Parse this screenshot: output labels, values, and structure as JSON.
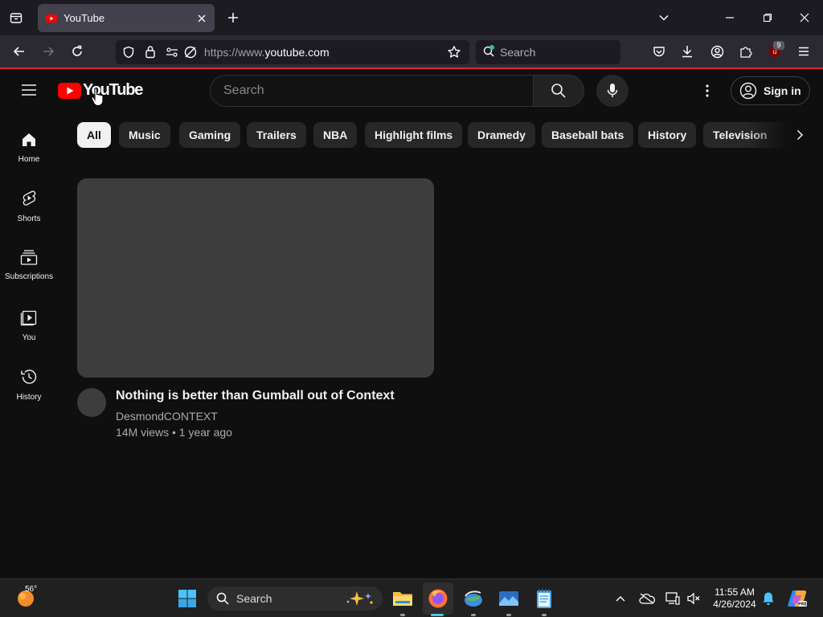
{
  "browser": {
    "tab_title": "YouTube",
    "url_prefix": "https://www.",
    "url_domain": "youtube.com",
    "search_placeholder": "Search",
    "extension_badge": "9"
  },
  "youtube": {
    "logo_text": "YouTube",
    "search_placeholder": "Search",
    "signin_label": "Sign in",
    "sidebar": [
      {
        "label": "Home",
        "icon": "home-icon"
      },
      {
        "label": "Shorts",
        "icon": "shorts-icon"
      },
      {
        "label": "Subscriptions",
        "icon": "subscriptions-icon"
      },
      {
        "label": "You",
        "icon": "you-icon"
      },
      {
        "label": "History",
        "icon": "history-icon"
      }
    ],
    "chips": [
      "All",
      "Music",
      "Gaming",
      "Trailers",
      "NBA",
      "Highlight films",
      "Dramedy",
      "Baseball bats",
      "History",
      "Television"
    ],
    "video": {
      "title": "Nothing is better than Gumball out of Context",
      "channel": "DesmondCONTEXT",
      "meta": "14M views • 1 year ago"
    }
  },
  "taskbar": {
    "weather_temp": "56°",
    "search_placeholder": "Search",
    "time": "11:55 AM",
    "date": "4/26/2024"
  },
  "colors": {
    "accent_red": "#ff0000",
    "browser_accent": "#e0262f"
  }
}
